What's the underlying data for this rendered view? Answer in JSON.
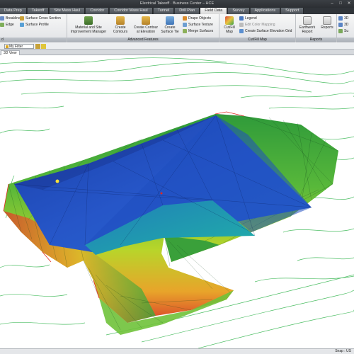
{
  "window": {
    "title": "Electrical Takeoff · Business Center – HCE"
  },
  "tabs": [
    {
      "label": "Data Prep",
      "active": false
    },
    {
      "label": "Takeoff",
      "active": false
    },
    {
      "label": "Site Mass Haul",
      "active": false
    },
    {
      "label": "Corridor",
      "active": false
    },
    {
      "label": "Corridor Mass Haul",
      "active": false
    },
    {
      "label": "Tunnel",
      "active": false
    },
    {
      "label": "Drill Plan",
      "active": false
    },
    {
      "label": "Field Data",
      "active": true
    },
    {
      "label": "Survey",
      "active": false
    },
    {
      "label": "Applications",
      "active": false
    },
    {
      "label": "Support",
      "active": false
    }
  ],
  "ribbon": {
    "left_group": {
      "items": [
        "Breakline",
        "Edge"
      ],
      "cross": [
        "Surface Cross Section",
        "Surface Profile"
      ],
      "label": "d"
    },
    "advanced": {
      "label": "Advanced Features",
      "material": "Material and Site Improvement Manager",
      "create_contours": "Create Contours",
      "create_contour_elev": "Create Contour at Elevation",
      "create_surface_tie": "Create Surface Tie",
      "small": [
        "Drape Objects",
        "Surface Texture",
        "Merge Surfaces"
      ]
    },
    "cutfill": {
      "label": "Cut/Fill Map",
      "cutfill_map": "Cut/Fill Map",
      "small": [
        "Legend",
        "Edit Color Mapping",
        "Create Surface Elevation Grid"
      ]
    },
    "reports": {
      "label": "Reports",
      "earthwork": "Earthwork Report",
      "reports": "Reports"
    },
    "right": {
      "small": [
        "3D",
        "3D",
        "Su"
      ]
    }
  },
  "filter": {
    "value": "My Filter"
  },
  "view_tab": "3D View",
  "status": {
    "snap": "Snap : US"
  },
  "colors": {
    "accent": "#3a73c4",
    "terrain_high": "#e0402a",
    "terrain_mid": "#b8d52a",
    "terrain_low": "#1e9a3a",
    "pad_blue": "#1f4fc0",
    "pad_teal": "#1a9aa8",
    "contour": "#0a9a2a"
  }
}
